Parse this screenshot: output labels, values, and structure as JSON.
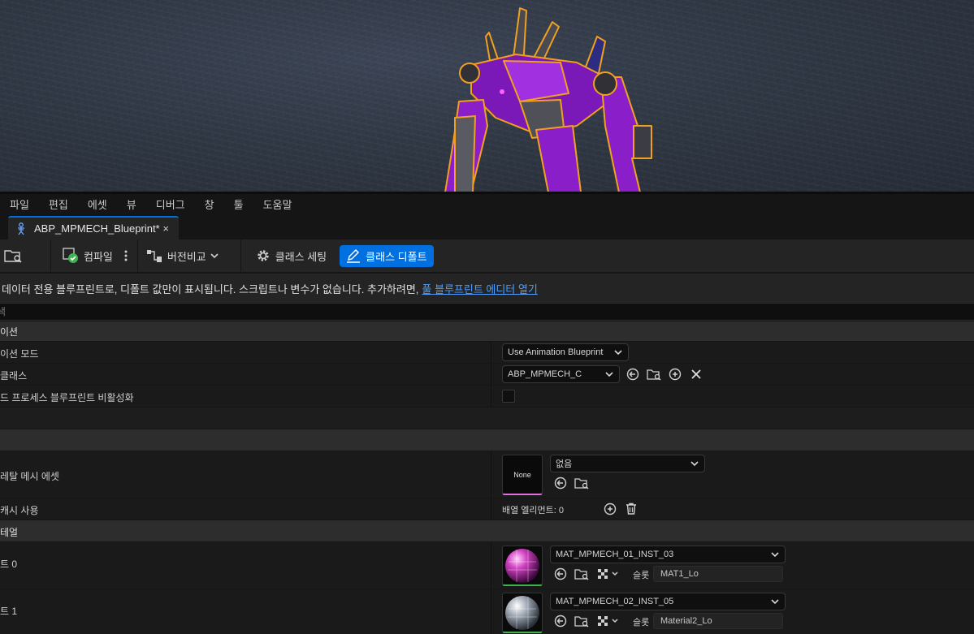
{
  "menu": [
    "파일",
    "편집",
    "에셋",
    "뷰",
    "디버그",
    "창",
    "툴",
    "도움말"
  ],
  "tab": {
    "title": "ABP_MPMECH_Blueprint*",
    "close": "×"
  },
  "toolbar": {
    "compile": "컴파일",
    "diff": "버전비교",
    "class_settings": "클래스 세팅",
    "class_defaults": "클래스 디폴트"
  },
  "infobar": {
    "text": "데이터 전용 블루프린트로, 디폴트 값만이 표시됩니다. 스크립트나 변수가 없습니다. 추가하려면,",
    "link": "풀 블루프린트 에디터 열기"
  },
  "search": {
    "placeholder": "색"
  },
  "details": {
    "cat_animation": "이션",
    "anim_mode_label": "이션 모드",
    "anim_mode_value": "Use Animation Blueprint",
    "anim_class_label": "클래스",
    "anim_class_value": "ABP_MPMECH_C",
    "postprocess_label": "드 프로세스 블루프린트 비활성화",
    "mesh_asset_label": "레탈 메시 에셋",
    "mesh_thumb": "None",
    "mesh_value": "없음",
    "use_mesh_label": "캐시 사용",
    "array_elements": "배열 엘리먼트: 0",
    "cat_materials": "테얼",
    "element0_label": "트 0",
    "element0_value": "MAT_MPMECH_01_INST_03",
    "element0_slot": "MAT1_Lo",
    "element1_label": "트 1",
    "element1_value": "MAT_MPMECH_02_INST_05",
    "element1_slot": "Material2_Lo",
    "slot_label": "슬롯"
  },
  "colors": {
    "accent": "#0070e0",
    "link": "#4d9eff",
    "highlight": "#f0a020",
    "mech": "#8a1ec8"
  }
}
